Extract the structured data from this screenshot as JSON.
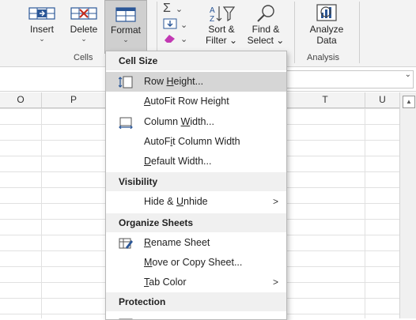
{
  "ribbon": {
    "cells_group": {
      "label": "Cells",
      "buttons": [
        {
          "label": "Insert",
          "caret": "⌄"
        },
        {
          "label": "Delete",
          "caret": "⌄"
        },
        {
          "label": "Format",
          "caret": "⌄"
        }
      ]
    },
    "editing_group": {
      "autosum_caret": "⌄",
      "fill_caret": "⌄",
      "clear_caret": "⌄",
      "sort_filter": {
        "line1": "Sort &",
        "line2": "Filter ⌄"
      },
      "find_select": {
        "line1": "Find &",
        "line2": "Select ⌄"
      }
    },
    "analysis_group": {
      "label": "Analysis",
      "analyze": {
        "line1": "Analyze",
        "line2": "Data"
      }
    }
  },
  "formula_bar": {
    "chevron": "⌄"
  },
  "columns": [
    "O",
    "P",
    "T",
    "U"
  ],
  "scrollbar": {
    "up": "▲"
  },
  "menu": {
    "cell_size_header": "Cell Size",
    "row_height": {
      "pre": "Row ",
      "u": "H",
      "post": "eight..."
    },
    "autofit_row_height": {
      "pre": "",
      "u": "A",
      "post": "utoFit Row Height"
    },
    "column_width": {
      "pre": "Column ",
      "u": "W",
      "post": "idth..."
    },
    "autofit_column_width": {
      "pre": "AutoF",
      "u": "i",
      "post": "t Column Width"
    },
    "default_width": {
      "pre": "",
      "u": "D",
      "post": "efault Width..."
    },
    "visibility_header": "Visibility",
    "hide_unhide": {
      "pre": "Hide & ",
      "u": "U",
      "post": "nhide"
    },
    "organize_header": "Organize Sheets",
    "rename_sheet": {
      "pre": "",
      "u": "R",
      "post": "ename Sheet"
    },
    "move_copy": {
      "pre": "",
      "u": "M",
      "post": "ove or Copy Sheet..."
    },
    "tab_color": {
      "pre": "",
      "u": "T",
      "post": "ab Color"
    },
    "protection_header": "Protection",
    "submenu_arrow": ">"
  },
  "colors": {
    "ribbon_bg": "#f3f3f3",
    "highlight": "#d6d6d6",
    "icon_blue": "#2b5797"
  }
}
